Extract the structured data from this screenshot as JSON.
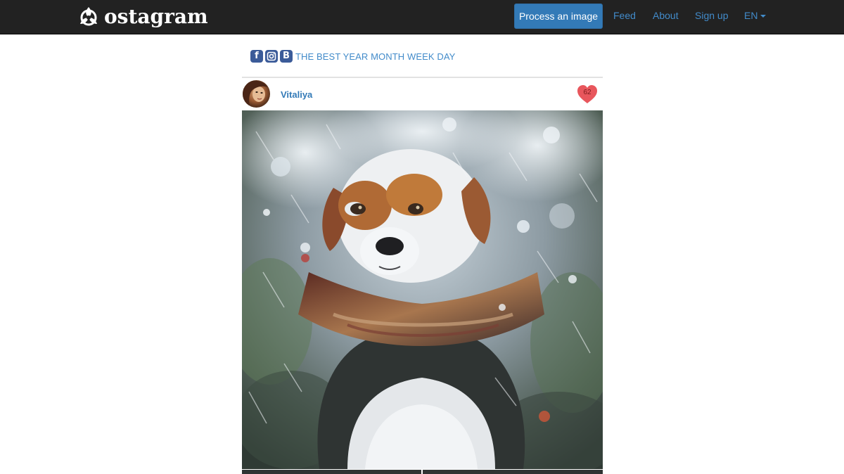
{
  "app": {
    "brand_name": "ostagram",
    "brand_icon": "triskelion-logo-icon"
  },
  "nav": {
    "process_label": "Process an image",
    "feed_label": "Feed",
    "about_label": "About",
    "signup_label": "Sign up",
    "lang_label": "EN",
    "link_color": "#428bca",
    "primary_color": "#337ab7",
    "navbar_color": "#222222"
  },
  "social": {
    "icons": [
      "facebook-icon",
      "instagram-icon",
      "vk-icon"
    ],
    "facebook_glyph": "f",
    "vk_glyph": "B",
    "tagline": "THE BEST YEAR MONTH WEEK DAY"
  },
  "post": {
    "username": "Vitaliya",
    "likes": "62",
    "like_color": "#e8565c",
    "image_subject": "stylized painting of a dog with scarf in rain"
  }
}
